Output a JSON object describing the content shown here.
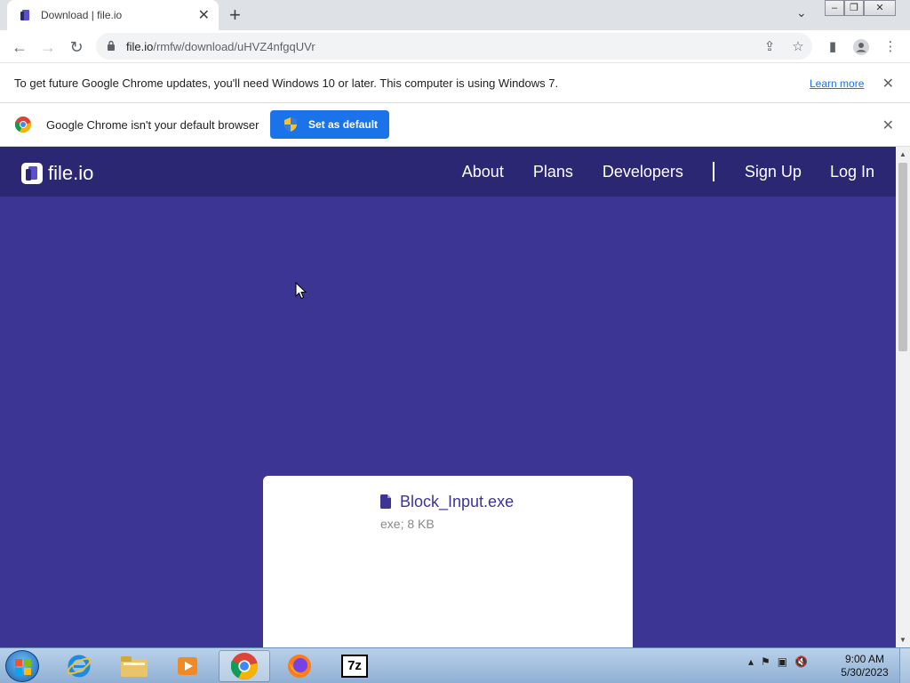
{
  "browser": {
    "tab_title": "Download | file.io",
    "url_host": "file.io",
    "url_path": "/rmfw/download/uHVZ4nfgqUVr",
    "new_tab_symbol": "+",
    "tab_close_symbol": "✕"
  },
  "infobar_update": {
    "message": "To get future Google Chrome updates, you'll need Windows 10 or later. This computer is using Windows 7.",
    "link": "Learn more"
  },
  "infobar_default": {
    "message": "Google Chrome isn't your default browser",
    "button": "Set as default"
  },
  "site": {
    "brand": "file.io",
    "nav": {
      "about": "About",
      "plans": "Plans",
      "developers": "Developers",
      "signup": "Sign Up",
      "login": "Log In"
    },
    "colors": {
      "header": "#2c2773",
      "background": "#3c3594",
      "card": "#ffffff"
    }
  },
  "file": {
    "name": "Block_Input.exe",
    "meta": "exe; 8 KB"
  },
  "taskbar": {
    "apps": [
      "start-orb",
      "internet-explorer",
      "file-explorer",
      "media-player",
      "google-chrome",
      "firefox",
      "7-zip"
    ],
    "active_app": "google-chrome",
    "time": "9:00 AM",
    "date": "5/30/2023",
    "sevenzip_label": "7z"
  }
}
